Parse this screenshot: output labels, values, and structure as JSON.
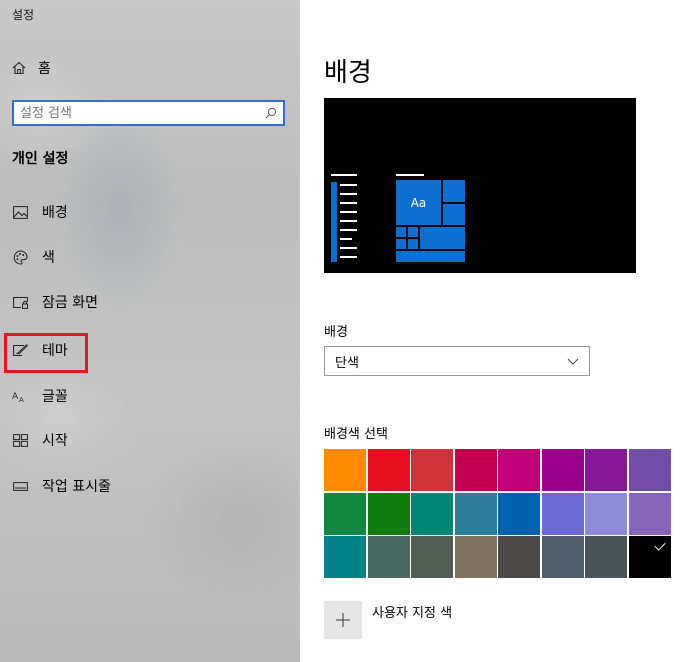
{
  "window": {
    "title": "설정"
  },
  "sidebar": {
    "home_label": "홈",
    "search_placeholder": "설정 검색",
    "section_title": "개인 설정",
    "items": [
      {
        "label": "배경",
        "icon": "picture-icon"
      },
      {
        "label": "색",
        "icon": "palette-icon"
      },
      {
        "label": "잠금 화면",
        "icon": "lock-screen-icon"
      },
      {
        "label": "테마",
        "icon": "theme-brush-icon"
      },
      {
        "label": "글꼴",
        "icon": "font-icon"
      },
      {
        "label": "시작",
        "icon": "start-grid-icon"
      },
      {
        "label": "작업 표시줄",
        "icon": "taskbar-icon"
      }
    ],
    "highlighted_item": "테마"
  },
  "main": {
    "title": "배경",
    "preview_text": "Aa",
    "background_label": "배경",
    "background_value": "단색",
    "color_label": "배경색 선택",
    "custom_color_label": "사용자 지정 색",
    "colors": [
      "#ff8c00",
      "#e81123",
      "#d13438",
      "#c30052",
      "#bf0077",
      "#9a0089",
      "#881798",
      "#744da9",
      "#10893e",
      "#107c10",
      "#018574",
      "#2d7d9a",
      "#0063b1",
      "#6b69d6",
      "#8e8cd8",
      "#8764b8",
      "#038387",
      "#486860",
      "#525e54",
      "#7e735f",
      "#4c4a48",
      "#515c6b",
      "#4a5459",
      "#000000"
    ],
    "selected_color": "#000000",
    "accent": "#0a6fce"
  }
}
